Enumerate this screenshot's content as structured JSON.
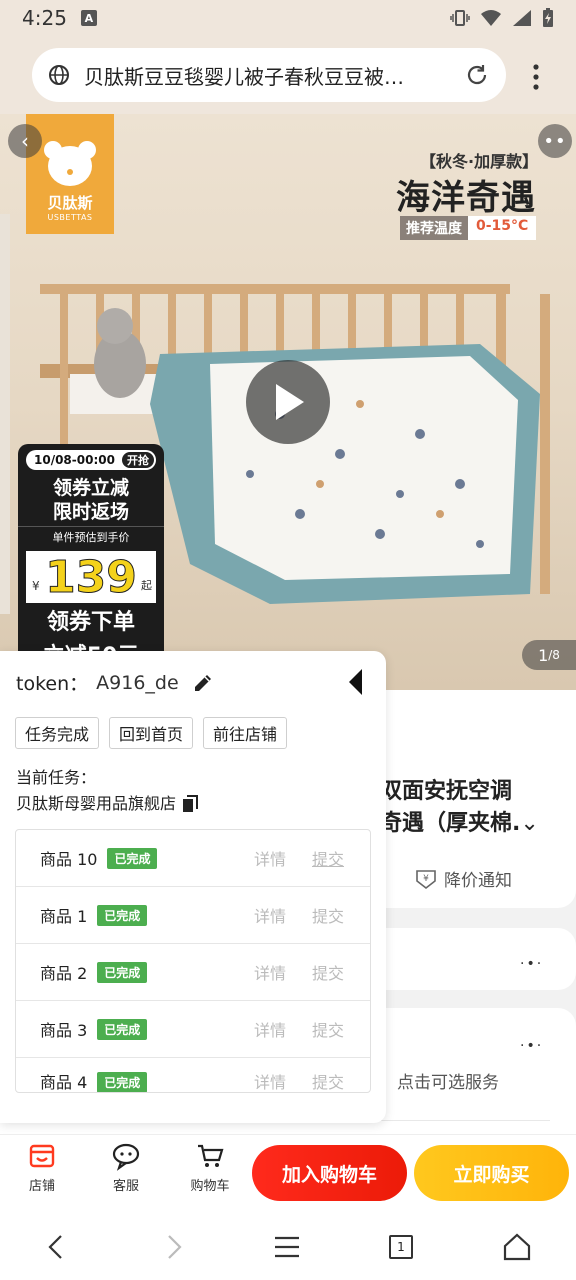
{
  "status_bar": {
    "time": "4:25",
    "notif_glyph": "A"
  },
  "browser": {
    "page_title": "贝肽斯豆豆毯婴儿被子春秋豆豆被…"
  },
  "hero": {
    "brand_cn": "贝肽斯",
    "brand_en": "USBETTAS",
    "season_tag": "【秋冬·加厚款】",
    "title": "海洋奇遇",
    "temp_label": "推荐温度",
    "temp_value": "0-15°C",
    "counter_current": "1",
    "counter_total": "/8",
    "promo": {
      "date": "10/08-00:00",
      "open_label": "开抢",
      "line1": "领券立减",
      "line2": "限时返场",
      "sub": "单件预估到手价",
      "currency": "¥",
      "price": "139",
      "qi": "起",
      "line3": "领券下单",
      "line4": "立减50元"
    }
  },
  "product": {
    "title_line1": "双面安抚空调",
    "title_line2": "奇遇（厚夹棉.",
    "price_notify": "降价通知",
    "service_hint": "，点击可选服务"
  },
  "panel": {
    "token_label": "token：",
    "token_value": "A916_de",
    "buttons": [
      "任务完成",
      "回到首页",
      "前往店铺"
    ],
    "current_task_label": "当前任务：",
    "shop_name": "贝肽斯母婴用品旗舰店",
    "detail_label": "详情",
    "submit_label": "提交",
    "tasks": [
      {
        "name": "商品 10",
        "status": "已完成"
      },
      {
        "name": "商品 1",
        "status": "已完成"
      },
      {
        "name": "商品 2",
        "status": "已完成"
      },
      {
        "name": "商品 3",
        "status": "已完成"
      },
      {
        "name": "商品 4",
        "status": "已完成"
      }
    ]
  },
  "actionbar": {
    "store": "店铺",
    "service": "客服",
    "cart": "购物车",
    "add_to_cart": "加入购物车",
    "buy_now": "立即购买"
  },
  "navbar": {
    "tabs_count": "1"
  },
  "colors": {
    "accent_red": "#ec1b08",
    "accent_yellow": "#ffb40a",
    "brand_orange": "#f0a93b",
    "done_green": "#4cae4f"
  }
}
